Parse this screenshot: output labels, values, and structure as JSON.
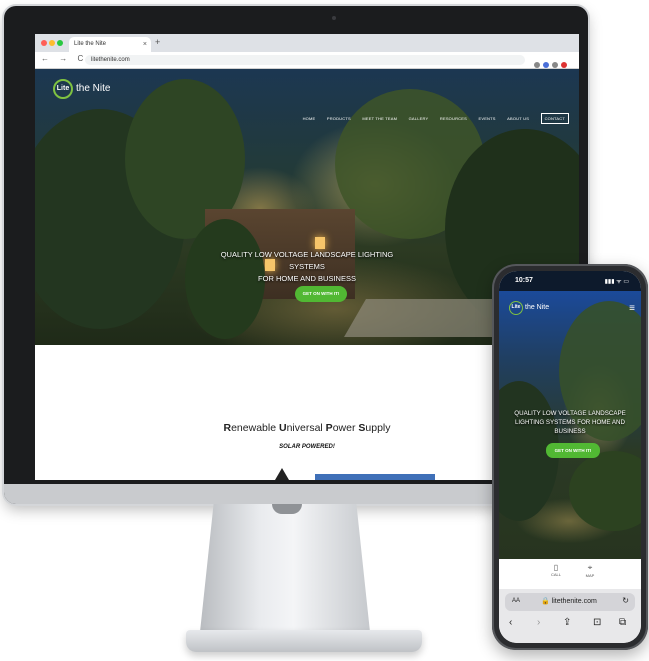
{
  "browser": {
    "tab_title": "Lite the Nite",
    "tab_close": "×",
    "new_tab": "+",
    "nav_icons": "← → C ⌂",
    "url": "litethenite.com"
  },
  "site": {
    "logo_mark": "Lite",
    "logo_text": "the Nite",
    "nav": [
      "HOME",
      "PRODUCTS",
      "MEET THE TEAM",
      "GALLERY",
      "RESOURCES",
      "EVENTS",
      "ABOUT US",
      "CONTACT"
    ],
    "hero_title_line1": "QUALITY LOW VOLTAGE LANDSCAPE LIGHTING SYSTEMS",
    "hero_title_line2": "FOR HOME AND BUSINESS",
    "hero_button": "GET ON WITH IT!",
    "section_title_parts": [
      "R",
      "enewable ",
      "U",
      "niversal ",
      "P",
      "ower ",
      "S",
      "upply"
    ],
    "section_subtitle": "SOLAR POWERED!"
  },
  "phone": {
    "time": "10:57",
    "signal": "▮▮▮ ᯤ ▭",
    "logo_mark": "Lite",
    "logo_text": "the Nite",
    "menu_icon": "≡",
    "hero_title": "QUALITY LOW VOLTAGE LANDSCAPE LIGHTING SYSTEMS FOR HOME AND BUSINESS",
    "hero_button": "GET ON WITH IT!",
    "bottom_call_icon": "▯",
    "bottom_call": "CALL",
    "bottom_map_icon": "⌖",
    "bottom_map": "MAP",
    "safari_aa": "AA",
    "safari_url": "🔒 litethenite.com",
    "safari_reload": "↻",
    "tool_back": "‹",
    "tool_forward": "›",
    "tool_share": "⇪",
    "tool_bookmarks": "⊡",
    "tool_tabs": "⧉"
  },
  "colors": {
    "accent_green": "#51b833",
    "logo_green": "#7fc241",
    "bezel": "#1b1c1e"
  }
}
